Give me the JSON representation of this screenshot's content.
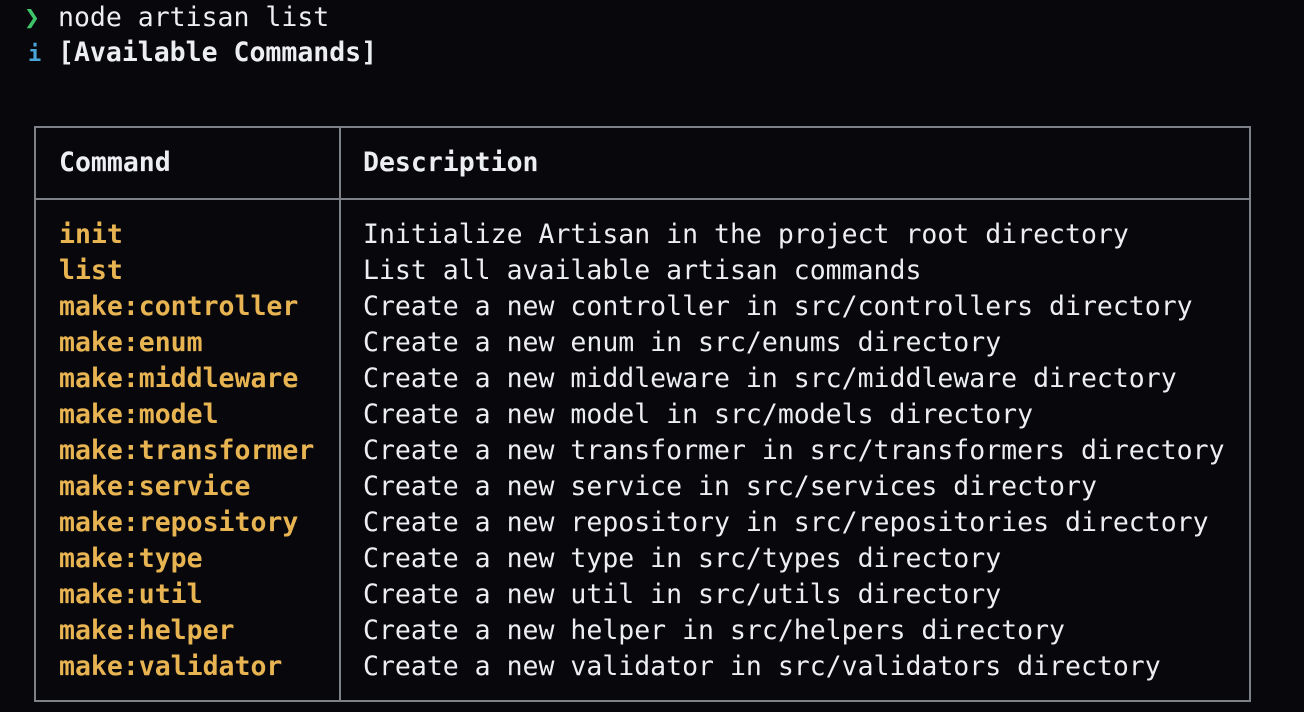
{
  "terminal": {
    "prompt_symbol": "❯",
    "command": "node artisan list",
    "info_icon": "i",
    "info_text": "[Available Commands]"
  },
  "table": {
    "headers": {
      "command": "Command",
      "description": "Description"
    },
    "rows": [
      {
        "command": "init",
        "description": "Initialize Artisan in the project root directory"
      },
      {
        "command": "list",
        "description": "List all available artisan commands"
      },
      {
        "command": "make:controller",
        "description": "Create a new controller in src/controllers directory"
      },
      {
        "command": "make:enum",
        "description": "Create a new enum in src/enums directory"
      },
      {
        "command": "make:middleware",
        "description": "Create a new middleware in src/middleware directory"
      },
      {
        "command": "make:model",
        "description": "Create a new model in src/models directory"
      },
      {
        "command": "make:transformer",
        "description": "Create a new transformer in src/transformers directory"
      },
      {
        "command": "make:service",
        "description": "Create a new service in src/services directory"
      },
      {
        "command": "make:repository",
        "description": "Create a new repository in src/repositories directory"
      },
      {
        "command": "make:type",
        "description": "Create a new type in src/types directory"
      },
      {
        "command": "make:util",
        "description": "Create a new util in src/utils directory"
      },
      {
        "command": "make:helper",
        "description": "Create a new helper in src/helpers directory"
      },
      {
        "command": "make:validator",
        "description": "Create a new validator in src/validators directory"
      }
    ]
  },
  "colors": {
    "background": "#07070c",
    "text": "#eceef1",
    "prompt_green": "#3fc46a",
    "info_blue": "#4aa6d8",
    "command_gold": "#e8b452",
    "border_gray": "#7f8189"
  }
}
